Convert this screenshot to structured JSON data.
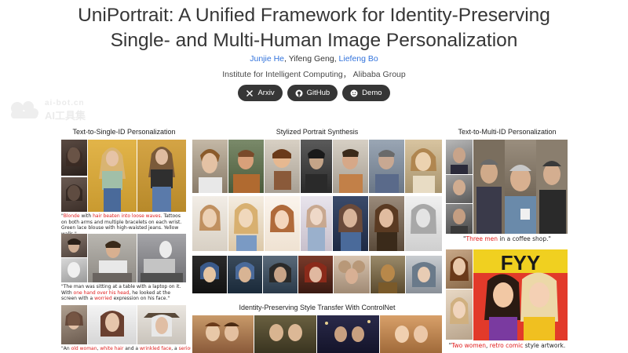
{
  "header": {
    "title_line1": "UniPortrait: A Unified Framework for Identity-Preserving",
    "title_line2": "Single- and Multi-Human Image Personalization",
    "authors": [
      {
        "name": "Junjie He",
        "link": true
      },
      {
        "name": "Yifeng Geng",
        "link": false
      },
      {
        "name": "Liefeng Bo",
        "link": true
      }
    ],
    "authors_sep1": ", ",
    "authors_sep2": ", ",
    "affiliation": "Institute for Intelligent Computing，  Alibaba Group"
  },
  "buttons": [
    {
      "label": "Arxiv",
      "icon": "x-icon"
    },
    {
      "label": "GitHub",
      "icon": "github-icon"
    },
    {
      "label": "Demo",
      "icon": "smiley-icon"
    }
  ],
  "watermark": {
    "line1": "ai-bot.cn",
    "line2": "AI工具集"
  },
  "sections": {
    "left_title": "Text-to-Single-ID Personalization",
    "middle_title": "Stylized Portrait Synthesis",
    "middle_lower_title": "Identity-Preserving Style Transfer With ControlNet",
    "right_title": "Text-to-Multi-ID Personalization"
  },
  "captions": {
    "left1": [
      {
        "t": "\"",
        "h": false
      },
      {
        "t": "Blonde",
        "h": true
      },
      {
        "t": " with ",
        "h": false
      },
      {
        "t": "hair beaten into loose waves",
        "h": true
      },
      {
        "t": ". Tattoos on both arms and multiple bracelets on each wrist. Green lace blouse with high-waisted jeans. Yellow walls.\"",
        "h": false
      }
    ],
    "left2": [
      {
        "t": "\"The man was sitting at a table with a laptop on it. With ",
        "h": false
      },
      {
        "t": "one hand over his head",
        "h": true
      },
      {
        "t": ", he looked at the screen with a ",
        "h": false
      },
      {
        "t": "worried",
        "h": true
      },
      {
        "t": " expression on his face.\"",
        "h": false
      }
    ],
    "left3": [
      {
        "t": "\"An ",
        "h": false
      },
      {
        "t": "old woman",
        "h": true
      },
      {
        "t": ", ",
        "h": false
      },
      {
        "t": "white hair",
        "h": true
      },
      {
        "t": " and a ",
        "h": false
      },
      {
        "t": "wrinkled face",
        "h": true
      },
      {
        "t": ", a ",
        "h": false
      },
      {
        "t": "serious",
        "h": true
      }
    ],
    "right1": [
      {
        "t": "\"",
        "h": false
      },
      {
        "t": "Three men",
        "h": true
      },
      {
        "t": " in a coffee shop.\"",
        "h": false
      }
    ],
    "right2": [
      {
        "t": "\"",
        "h": false
      },
      {
        "t": "Two women",
        "h": true
      },
      {
        "t": ", ",
        "h": false
      },
      {
        "t": "retro comic",
        "h": true
      },
      {
        "t": " style artwork.",
        "h": false
      }
    ]
  },
  "colors": {
    "title": "#363636",
    "link": "#3273dc",
    "button_bg": "#363636",
    "highlight": "#e01b1b"
  }
}
